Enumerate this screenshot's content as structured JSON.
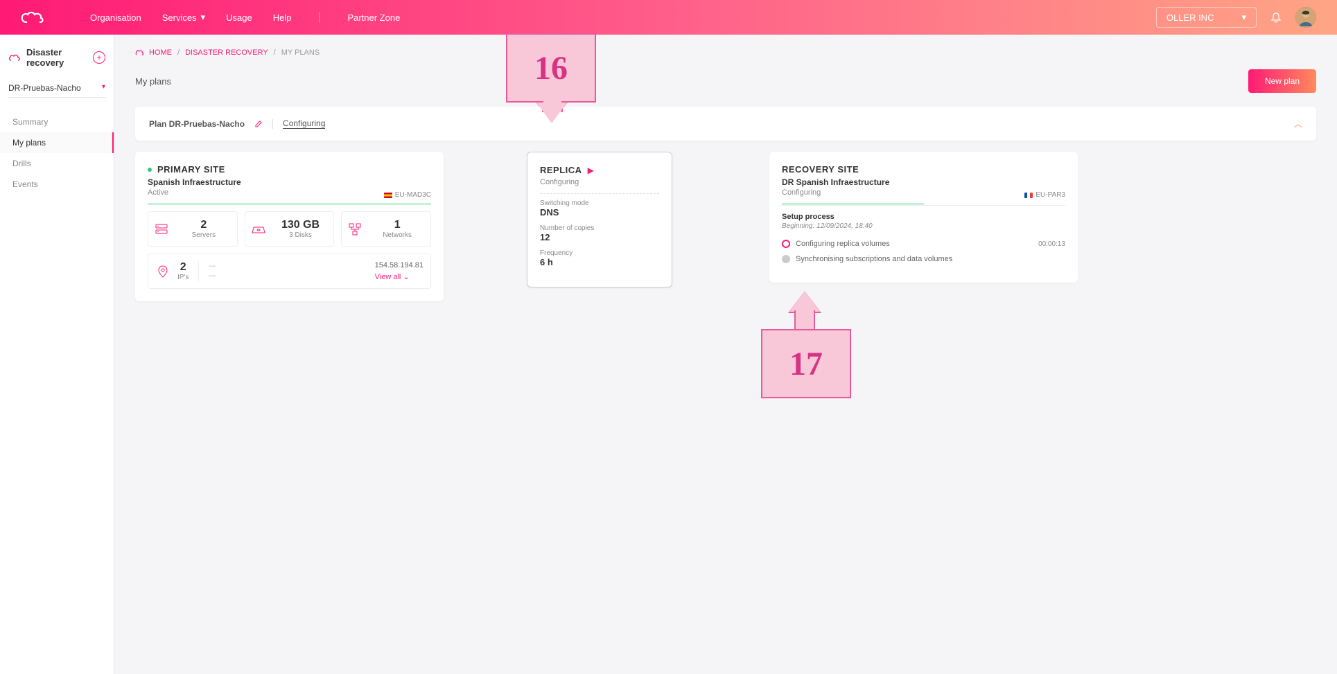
{
  "topnav": {
    "items": [
      "Organisation",
      "Services",
      "Usage",
      "Help",
      "Partner Zone"
    ],
    "org": "OLLER INC"
  },
  "sidebar": {
    "title": "Disaster recovery",
    "plan_selected": "DR-Pruebas-Nacho",
    "menu": [
      "Summary",
      "My plans",
      "Drills",
      "Events"
    ],
    "active_index": 1
  },
  "breadcrumb": {
    "home": "HOME",
    "sep": "/",
    "dr": "DISASTER RECOVERY",
    "current": "MY PLANS"
  },
  "page": {
    "title": "My plans",
    "new_plan": "New plan"
  },
  "plan_bar": {
    "name": "Plan DR-Pruebas-Nacho",
    "status": "Configuring"
  },
  "primary": {
    "title": "PRIMARY SITE",
    "subtitle": "Spanish Infraestructure",
    "status": "Active",
    "region": "EU-MAD3C",
    "stats": {
      "servers_val": "2",
      "servers_lbl": "Servers",
      "disks_val": "130 GB",
      "disks_lbl": "3 Disks",
      "networks_val": "1",
      "networks_lbl": "Networks",
      "ips_val": "2",
      "ips_lbl": "IP's",
      "dash1": "---",
      "dash2": "---",
      "ip_addr": "154.58.194.81",
      "view_all": "View all"
    }
  },
  "replica": {
    "title": "REPLICA",
    "status": "Configuring",
    "switch_lbl": "Switching mode",
    "switch_val": "DNS",
    "copies_lbl": "Number of copies",
    "copies_val": "12",
    "freq_lbl": "Frequency",
    "freq_val": "6 h"
  },
  "recovery": {
    "title": "RECOVERY SITE",
    "subtitle": "DR Spanish Infraestructure",
    "status": "Configuring",
    "region": "EU-PAR3",
    "setup_title": "Setup process",
    "beginning_lbl": "Beginning:",
    "beginning_val": "12/09/2024, 18:40",
    "step1": "Configuring replica volumes",
    "step1_time": "00:00:13",
    "step2": "Synchronising subscriptions and data volumes"
  },
  "annotations": {
    "a16": "16",
    "a17": "17"
  }
}
